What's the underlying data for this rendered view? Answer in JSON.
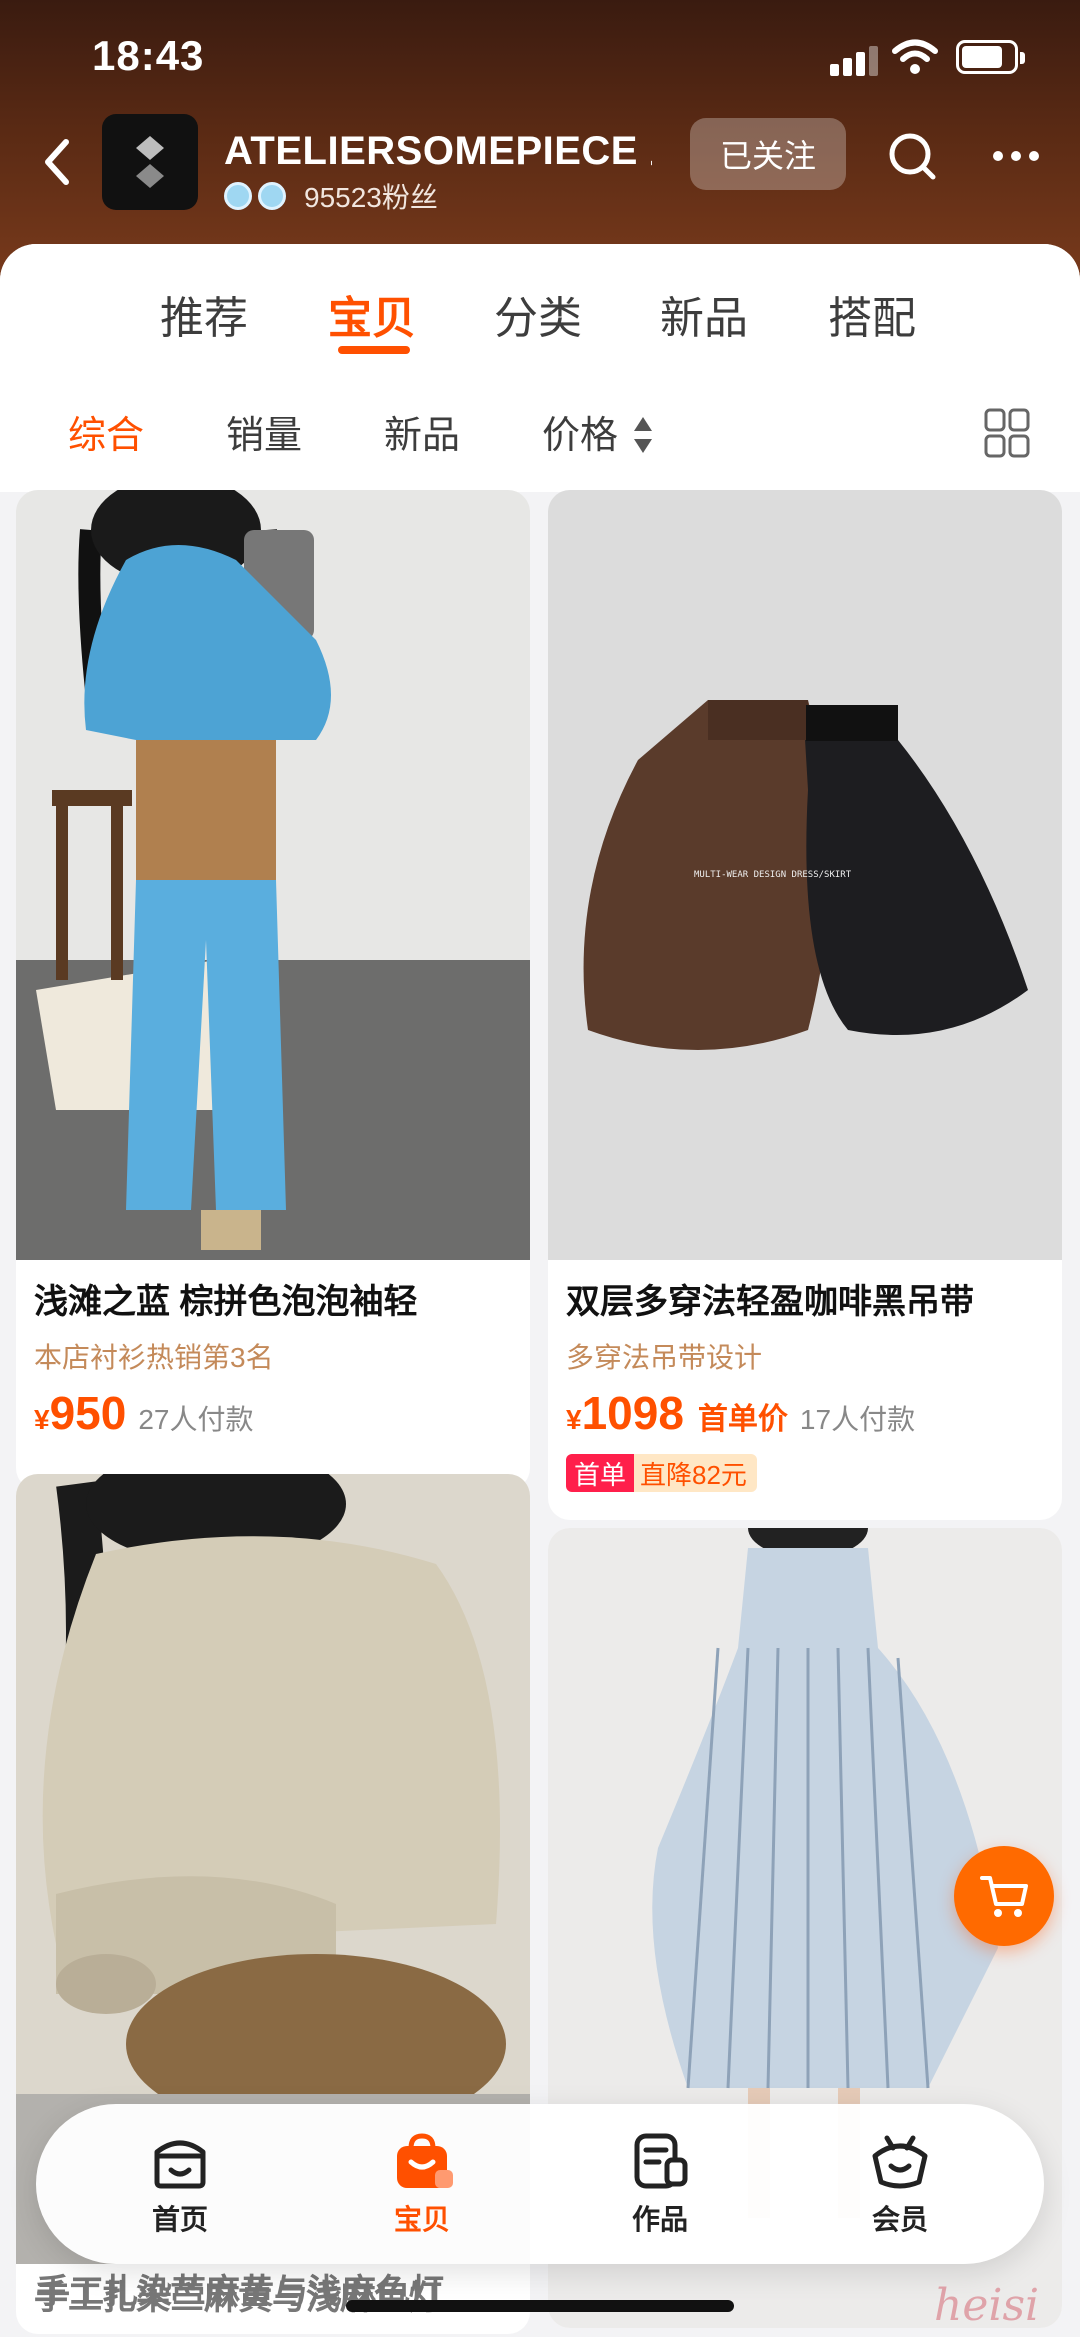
{
  "status_bar": {
    "time": "18:43"
  },
  "shop": {
    "name": "ATELIERSOMEPIECE 工砖",
    "fans": "95523粉丝",
    "follow_label": "已关注"
  },
  "tabs": [
    {
      "label": "推荐"
    },
    {
      "label": "宝贝"
    },
    {
      "label": "分类"
    },
    {
      "label": "新品"
    },
    {
      "label": "搭配"
    }
  ],
  "sort_options": [
    {
      "label": "综合"
    },
    {
      "label": "销量"
    },
    {
      "label": "新品"
    },
    {
      "label": "价格"
    }
  ],
  "products": [
    {
      "title": "浅滩之蓝 棕拼色泡泡袖轻",
      "subtitle": "本店衬衫热销第3名",
      "currency": "¥",
      "price": "950",
      "paid": "27人付款"
    },
    {
      "title": "双层多穿法轻盈咖啡黑吊带",
      "subtitle": "多穿法吊带设计",
      "currency": "¥",
      "price": "1098",
      "first_price_label": "首单价",
      "paid": "17人付款",
      "photo_text": "MULTI-WEAR DESIGN DRESS/SKIRT",
      "coupon": {
        "left": "首单",
        "right": "直降82元"
      }
    },
    {
      "title": "手工扎染苎麻黄与浅麻色灯"
    },
    {
      "title": ""
    }
  ],
  "bottom_nav": [
    {
      "label": "首页",
      "icon": "home-icon"
    },
    {
      "label": "宝贝",
      "icon": "shopping-bag-icon"
    },
    {
      "label": "作品",
      "icon": "works-icon"
    },
    {
      "label": "会员",
      "icon": "member-icon"
    }
  ],
  "watermark": "heisi",
  "colors": {
    "accent": "#ff5000",
    "header_bg": "#5a2a14",
    "coupon_red": "#ff1f4b"
  }
}
